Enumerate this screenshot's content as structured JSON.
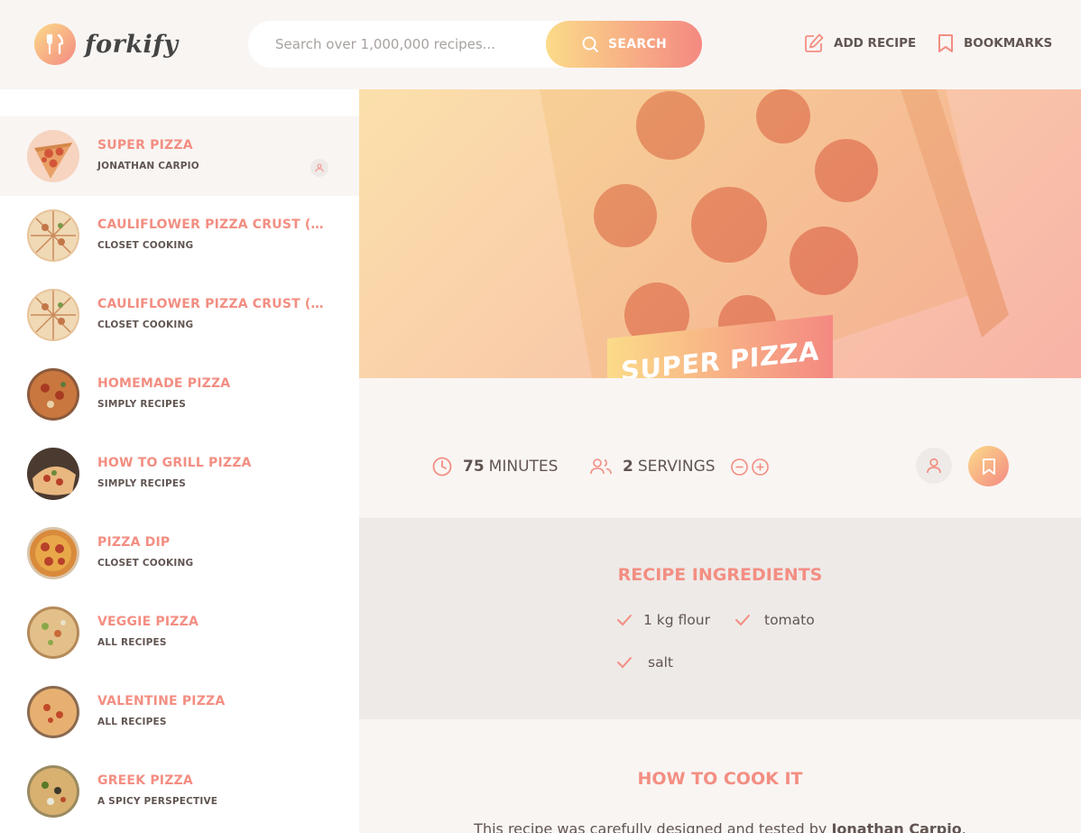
{
  "app": {
    "logo_text": "forkify"
  },
  "search": {
    "placeholder": "Search over 1,000,000 recipes...",
    "button_label": "SEARCH"
  },
  "nav": {
    "add_recipe": "ADD RECIPE",
    "bookmarks": "BOOKMARKS"
  },
  "results": [
    {
      "title": "SUPER PIZZA",
      "publisher": "JONATHAN CARPIO",
      "active": true,
      "user_generated": true,
      "thumb": "pepperoni-slice"
    },
    {
      "title": "CAULIFLOWER PIZZA CRUST (WITH BBQ CHICKEN)",
      "publisher": "CLOSET COOKING",
      "thumb": "cauliflower"
    },
    {
      "title": "CAULIFLOWER PIZZA CRUST (WITH BBQ CHICKEN)",
      "publisher": "CLOSET COOKING",
      "thumb": "cauliflower"
    },
    {
      "title": "HOMEMADE PIZZA",
      "publisher": "SIMPLY RECIPES",
      "thumb": "homemade"
    },
    {
      "title": "HOW TO GRILL PIZZA",
      "publisher": "SIMPLY RECIPES",
      "thumb": "grilled"
    },
    {
      "title": "PIZZA DIP",
      "publisher": "CLOSET COOKING",
      "thumb": "dip"
    },
    {
      "title": "VEGGIE PIZZA",
      "publisher": "ALL RECIPES",
      "thumb": "veggie"
    },
    {
      "title": "VALENTINE PIZZA",
      "publisher": "ALL RECIPES",
      "thumb": "valentine"
    },
    {
      "title": "GREEK PIZZA",
      "publisher": "A SPICY PERSPECTIVE",
      "thumb": "greek"
    }
  ],
  "recipe": {
    "title": "SUPER PIZZA",
    "cooking_time": "75",
    "cooking_time_unit": "MINUTES",
    "servings": "2",
    "servings_unit": "SERVINGS",
    "ingredients_title": "RECIPE INGREDIENTS",
    "ingredients": [
      "1 kg flour",
      "tomato",
      "salt"
    ],
    "directions_title": "HOW TO COOK IT",
    "directions_text_before": "This recipe was carefully designed and tested by ",
    "directions_publisher": "Jonathan Carpio",
    "directions_text_after": ". Please"
  },
  "colors": {
    "accent_light": "#fbdb89",
    "accent_dark": "#f48982",
    "accent_text": "#f38e82",
    "text": "#615551",
    "bg": "#f9f5f3"
  }
}
